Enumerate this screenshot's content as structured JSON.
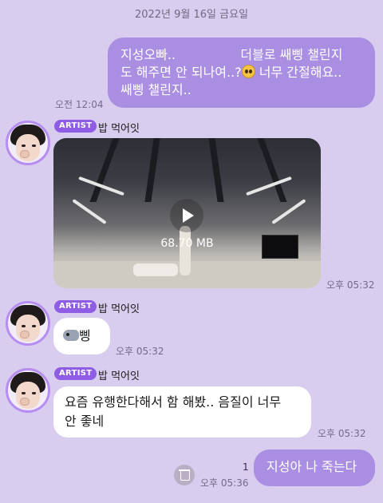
{
  "date_divider": "2022년 9월 16일 금요일",
  "messages": {
    "m1": {
      "lines": [
        "지성오빠..                더블로 쌔삥 챌린지",
        "도 해주면 안 되나여..?",
        "쌔삥 챌린지.."
      ],
      "line2_suffix": " 너무 간절해요..",
      "time": "오전 12:04"
    },
    "m2": {
      "badge": "ARTIST",
      "sender": "밥 먹어잇",
      "file_size": "68.70 MB",
      "time": "오후 05:32"
    },
    "m3": {
      "badge": "ARTIST",
      "sender": "밥 먹어잇",
      "text": "삥",
      "time": "오후 05:32"
    },
    "m4": {
      "badge": "ARTIST",
      "sender": "밥 먹어잇",
      "lines": [
        "요즘 유행한다해서 함 해봤.. 음질이 너무",
        "안 좋네"
      ],
      "time": "오후 05:32"
    },
    "m5": {
      "text": "지성아 나 죽는다",
      "unread": "1",
      "time": "오후 05:36"
    }
  },
  "colors": {
    "background": "#d8cdef",
    "my_bubble": "#a98ee2",
    "artist_badge": "#8f5ce6"
  }
}
